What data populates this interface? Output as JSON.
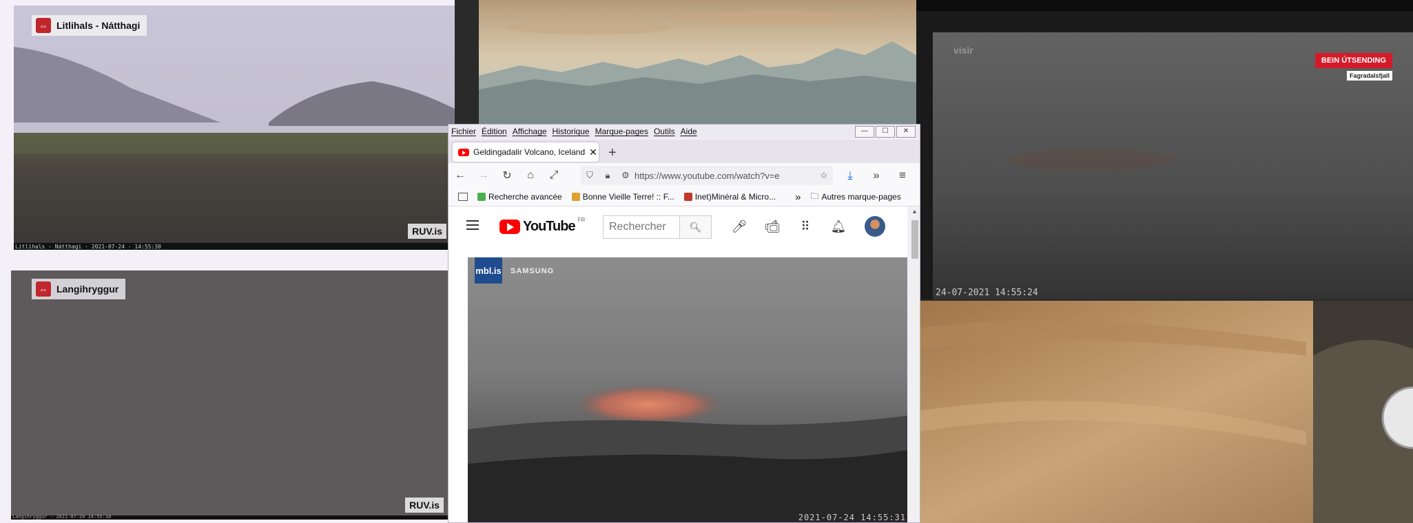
{
  "cameras": {
    "litlihals": {
      "label": "Litlihals - Nátthagi",
      "brand": "RUV.is",
      "timestamp": "Litlihals - Nátthagi - 2021-07-24 - 14:55:30"
    },
    "langihryggur": {
      "label": "Langihryggur",
      "brand": "RUV.is",
      "timestamp": "Langihryggur - 2021-07-24 14:55:30"
    },
    "visir": {
      "logo": "visir",
      "live_badge": "BEIN ÚTSENDING",
      "location": "Fagradalsfjall",
      "timestamp": "24-07-2021  14:55:24"
    }
  },
  "browser": {
    "menu": [
      "Fichier",
      "Édition",
      "Affichage",
      "Historique",
      "Marque-pages",
      "Outils",
      "Aide"
    ],
    "window_controls": {
      "minimize": "—",
      "maximize": "☐",
      "close": "✕"
    },
    "tab": {
      "title": "Geldingadalir Volcano, Iceland |",
      "close": "✕",
      "new_tab": "+"
    },
    "url": "https://www.youtube.com/watch?v=e",
    "bookmarks": [
      {
        "label": "Recherche avancée",
        "color": "#4caf50"
      },
      {
        "label": "Bonne Vieille Terre! :: F...",
        "color": "#e0a030"
      },
      {
        "label": "Inet)Minéral & Micro...",
        "color": "#c0392b"
      }
    ],
    "bookmarks_overflow": "»",
    "other_bookmarks": "Autres marque-pages"
  },
  "youtube": {
    "logo_text": "YouTube",
    "region": "FR",
    "search_placeholder": "Rechercher",
    "video": {
      "channel_logo": "mbl.is",
      "sponsor": "SAMSUNG",
      "timestamp": "2021-07-24  14:55:31"
    }
  },
  "colors": {
    "youtube_red": "#ff0000",
    "ruv_red": "#c0262d",
    "live_red": "#d41a2a",
    "mbl_blue": "#1f4c8f"
  }
}
